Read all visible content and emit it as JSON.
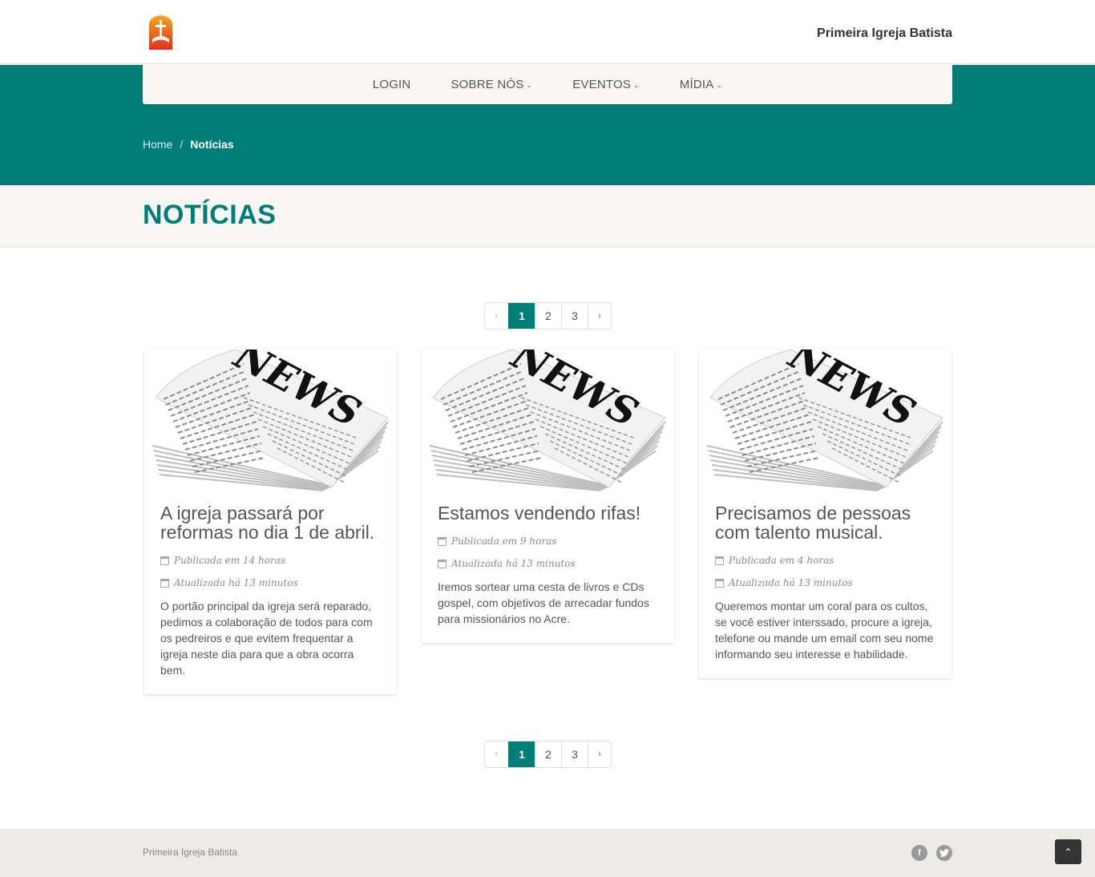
{
  "header": {
    "site_title": "Primeira Igreja Batista"
  },
  "nav": {
    "items": [
      {
        "label": "LOGIN"
      },
      {
        "label": "SOBRE NÓS"
      },
      {
        "label": "EVENTOS"
      },
      {
        "label": "MÍDIA"
      }
    ]
  },
  "breadcrumb": {
    "home": "Home",
    "separator": "/",
    "current": "Notícias"
  },
  "page": {
    "title": "NOTÍCIAS"
  },
  "pagination": {
    "prev": "‹",
    "pages": [
      "1",
      "2",
      "3"
    ],
    "next": "›",
    "active": "1"
  },
  "news": [
    {
      "title": "A igreja passará por reformas no dia 1 de abril.",
      "published": "Publicada em 14 horas",
      "updated": "Atualizada há 13 minutos",
      "text": "O portão principal da igreja será reparado, pedimos a colaboração de todos para com os pedreiros e que evitem frequentar a igreja neste dia para que a obra ocorra bem."
    },
    {
      "title": "Estamos vendendo rifas!",
      "published": "Publicada em 9 horas",
      "updated": "Atualizada há 13 minutos",
      "text": "Iremos sortear uma cesta de livros e CDs gospel, com objetivos de arrecadar fundos para missionários no Acre."
    },
    {
      "title": "Precisamos de pessoas com talento musical.",
      "published": "Publicada em 4 horas",
      "updated": "Atualizada há 13 minutos",
      "text": "Queremos montar um coral para os cultos, se você estiver interssado, procure a igreja, telefone ou mande um email com seu nome informando seu interesse e habilidade."
    }
  ],
  "card_image_text": "NEWS",
  "footer": {
    "text": "Primeira Igreja Batista",
    "social": [
      "facebook-icon",
      "twitter-icon"
    ]
  },
  "colors": {
    "teal": "#007d77",
    "nav_bg": "#f7f6f3",
    "footer_bg": "#ecebe7"
  }
}
